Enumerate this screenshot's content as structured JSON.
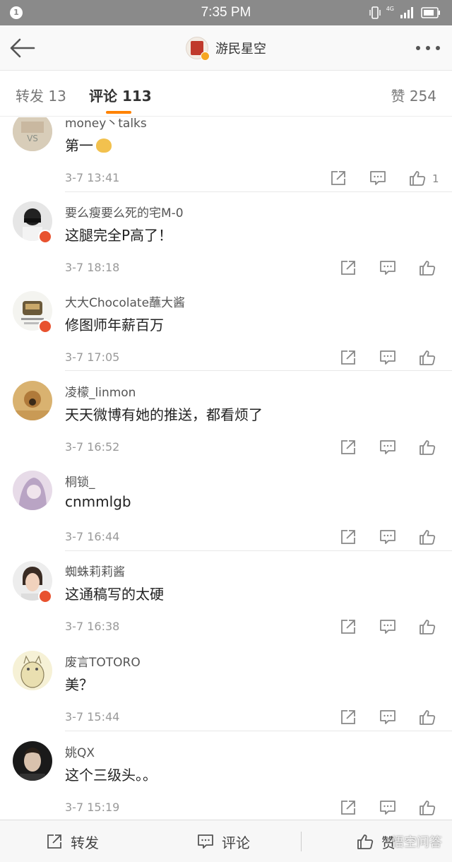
{
  "status_bar": {
    "notification_count": "1",
    "time": "7:35 PM",
    "network": "4G"
  },
  "nav": {
    "title": "游民星空",
    "icons": [
      "arrow-left-icon",
      "more-icon"
    ]
  },
  "tabs": {
    "repost": "转发 13",
    "comment": "评论 113",
    "like": "赞 254",
    "accent_color": "#ff8200"
  },
  "comments": [
    {
      "name": "money丶talks",
      "text": "第一",
      "time": "3-7 13:41",
      "like_count": "1",
      "verified": false
    },
    {
      "name": "要么瘦要么死的宅M-0",
      "text": "这腿完全P高了！",
      "time": "3-7 18:18",
      "like_count": "",
      "verified": true
    },
    {
      "name": "大大Chocolate蘸大酱",
      "text": "修图师年薪百万",
      "time": "3-7 17:05",
      "like_count": "",
      "verified": true
    },
    {
      "name": "凌檬_linmon",
      "text": "天天微博有她的推送，都看烦了",
      "time": "3-7 16:52",
      "like_count": "",
      "verified": false
    },
    {
      "name": "桐锁_",
      "text": "cnmmlgb",
      "time": "3-7 16:44",
      "like_count": "",
      "verified": false
    },
    {
      "name": "蜘蛛莉莉酱",
      "text": "这通稿写的太硬",
      "time": "3-7 16:38",
      "like_count": "",
      "verified": true
    },
    {
      "name": "废言TOTORO",
      "text": "美？",
      "time": "3-7 15:44",
      "like_count": "",
      "verified": false
    },
    {
      "name": "姚QX",
      "text": "这个三级头。。",
      "time": "3-7 15:19",
      "like_count": "",
      "verified": false
    }
  ],
  "bottom_bar": {
    "repost": "转发",
    "comment": "评论",
    "like": "赞"
  },
  "watermark": "悟空问答"
}
